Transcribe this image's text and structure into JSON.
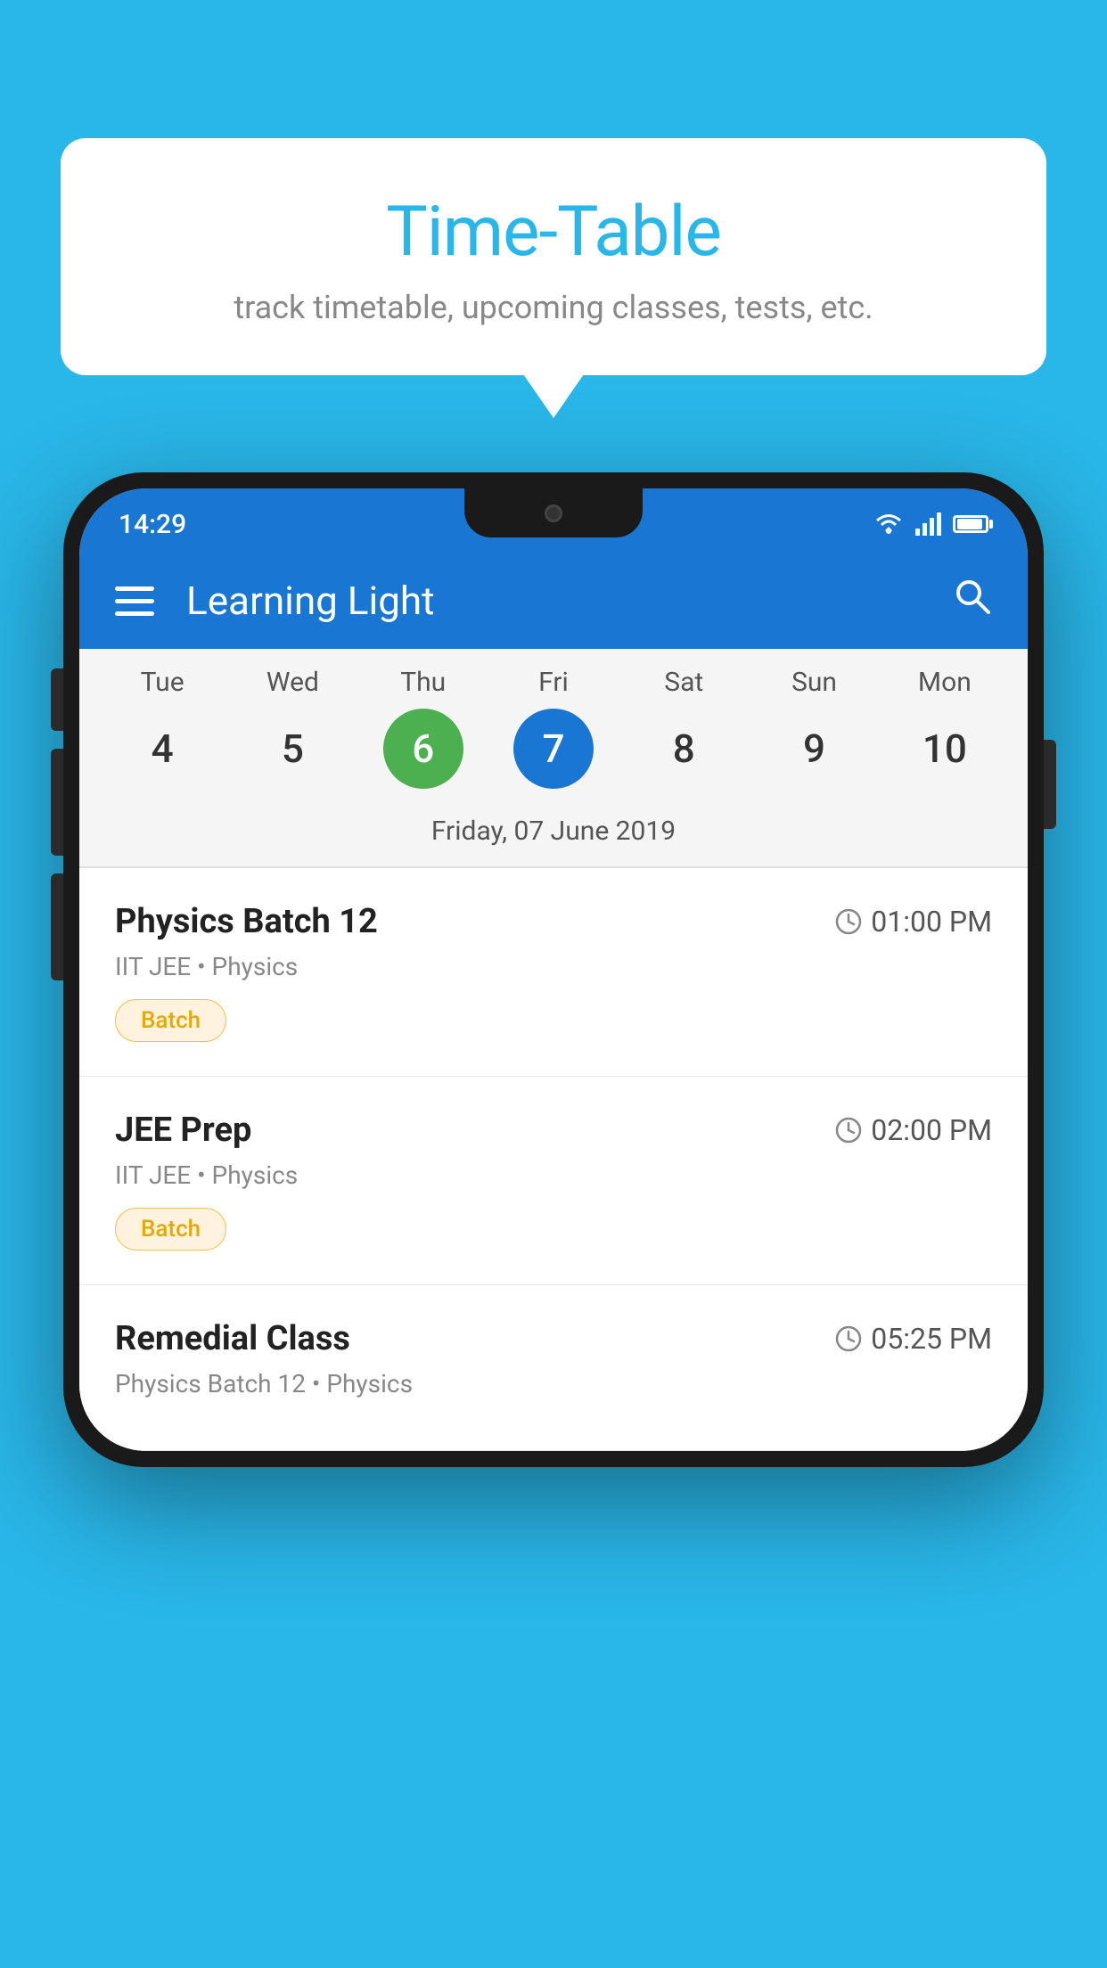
{
  "background_color": "#29b6e8",
  "bubble": {
    "title": "Time-Table",
    "subtitle": "track timetable, upcoming classes, tests, etc."
  },
  "phone": {
    "status_bar": {
      "time": "14:29"
    },
    "header": {
      "title": "Learning Light"
    },
    "calendar": {
      "days": [
        {
          "name": "Tue",
          "num": "4",
          "state": "normal"
        },
        {
          "name": "Wed",
          "num": "5",
          "state": "normal"
        },
        {
          "name": "Thu",
          "num": "6",
          "state": "today"
        },
        {
          "name": "Fri",
          "num": "7",
          "state": "selected"
        },
        {
          "name": "Sat",
          "num": "8",
          "state": "normal"
        },
        {
          "name": "Sun",
          "num": "9",
          "state": "normal"
        },
        {
          "name": "Mon",
          "num": "10",
          "state": "normal"
        }
      ],
      "selected_date_label": "Friday, 07 June 2019"
    },
    "schedule": [
      {
        "name": "Physics Batch 12",
        "time": "01:00 PM",
        "meta": "IIT JEE • Physics",
        "badge": "Batch"
      },
      {
        "name": "JEE Prep",
        "time": "02:00 PM",
        "meta": "IIT JEE • Physics",
        "badge": "Batch"
      },
      {
        "name": "Remedial Class",
        "time": "05:25 PM",
        "meta": "Physics Batch 12 • Physics",
        "badge": null
      }
    ]
  }
}
